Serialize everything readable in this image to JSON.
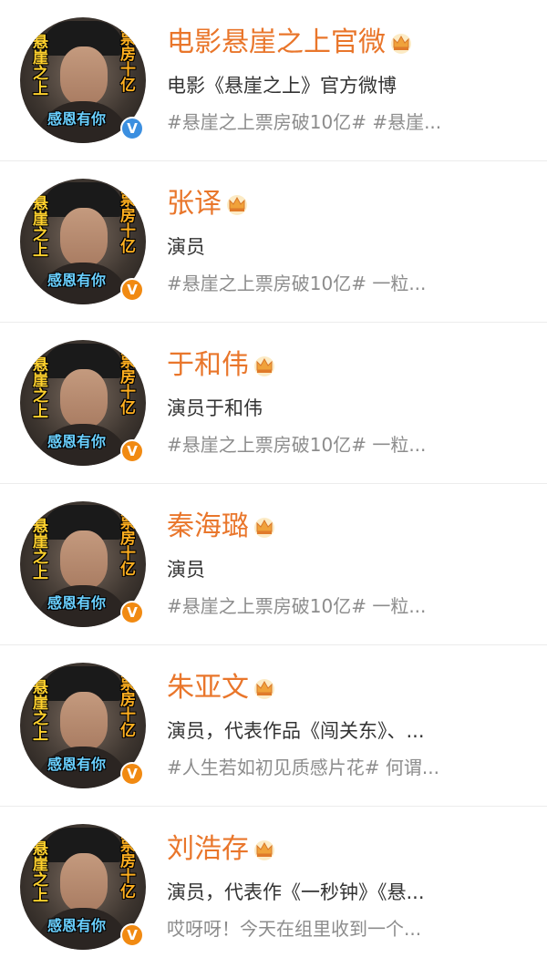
{
  "accounts": [
    {
      "name": "电影悬崖之上官微",
      "description": "电影《悬崖之上》官方微博",
      "post": "#悬崖之上票房破10亿# #悬崖...",
      "verify": "blue",
      "avatar_text": {
        "left": "悬崖之上",
        "right": "票房十亿",
        "bottom": "感恩有你"
      }
    },
    {
      "name": "张译",
      "description": "演员",
      "post": "#悬崖之上票房破10亿# 一粒...",
      "verify": "orange",
      "avatar_text": {
        "left": "悬崖之上",
        "right": "票房十亿",
        "bottom": "感恩有你"
      }
    },
    {
      "name": "于和伟",
      "description": "演员于和伟",
      "post": "#悬崖之上票房破10亿# 一粒...",
      "verify": "orange",
      "avatar_text": {
        "left": "悬崖之上",
        "right": "票房十亿",
        "bottom": "感恩有你"
      }
    },
    {
      "name": "秦海璐",
      "description": "演员",
      "post": "#悬崖之上票房破10亿# 一粒...",
      "verify": "orange",
      "avatar_text": {
        "left": "悬崖之上",
        "right": "票房十亿",
        "bottom": "感恩有你"
      }
    },
    {
      "name": "朱亚文",
      "description": "演员，代表作品《闯关东》、...",
      "post": "#人生若如初见质感片花# 何谓...",
      "verify": "orange",
      "avatar_text": {
        "left": "悬崖之上",
        "right": "票房十亿",
        "bottom": "感恩有你"
      }
    },
    {
      "name": "刘浩存",
      "description": "演员，代表作《一秒钟》《悬...",
      "post": "哎呀呀！今天在组里收到一个...",
      "verify": "orange",
      "avatar_text": {
        "left": "悬崖之上",
        "right": "票房十亿",
        "bottom": "感恩有你"
      }
    }
  ],
  "icons": {
    "crown": "crown-icon",
    "verify": "verified-v-icon"
  },
  "verify_label": "V",
  "colors": {
    "name": "#e9762b",
    "description": "#333333",
    "post": "#8c8c8c",
    "verify_blue": "#3b8fe0",
    "verify_orange": "#f18a12",
    "divider": "#ececec"
  }
}
